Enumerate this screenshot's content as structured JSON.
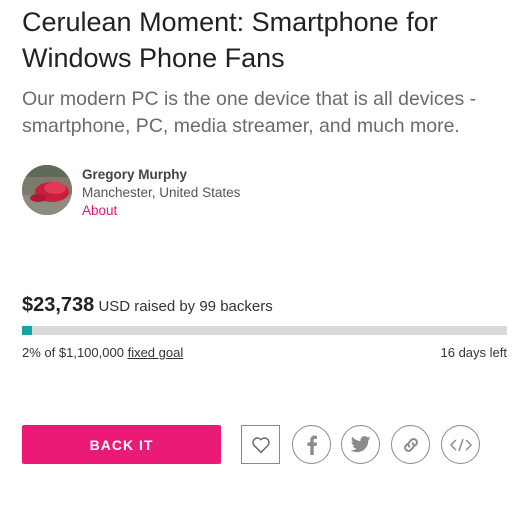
{
  "project": {
    "title": "Cerulean Moment: Smartphone for Windows Phone Fans",
    "blurb": "Our modern PC is the one device that is all devices - smartphone, PC, media streamer, and much more."
  },
  "owner": {
    "name": "Gregory Murphy",
    "location": "Manchester, United States",
    "about_link": "About"
  },
  "funding": {
    "amount": "$23,738",
    "raised_text": "USD raised by 99 backers",
    "percent_label": "2%",
    "goal_text": "of $1,100,000",
    "goal_type": "fixed goal",
    "days_left": "16 days left",
    "progress_fraction": 0.02,
    "bar_color": "#16a5a7"
  },
  "actions": {
    "back_label": "BACK IT",
    "back_color": "#ec1a77",
    "icons": [
      "heart-icon",
      "facebook-icon",
      "twitter-icon",
      "link-icon",
      "embed-icon"
    ]
  }
}
